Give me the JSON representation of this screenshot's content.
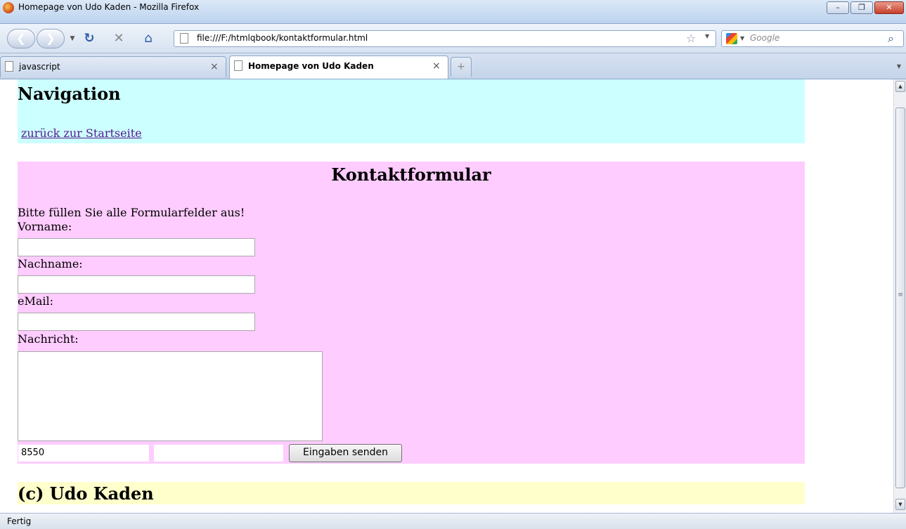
{
  "window": {
    "title": "Homepage von Udo Kaden - Mozilla Firefox",
    "minimize": "–",
    "maximize": "❐",
    "close": "✕"
  },
  "toolbar": {
    "back_icon": "back-arrow-icon",
    "forward_icon": "forward-arrow-icon",
    "url": "file:///F:/htmlqbook/kontaktformular.html",
    "search_placeholder": "Google"
  },
  "tabs": [
    {
      "label": "javascript",
      "active": false
    },
    {
      "label": "Homepage von Udo Kaden",
      "active": true
    }
  ],
  "page": {
    "nav_heading": "Navigation",
    "nav_link": "zurück zur Startseite",
    "form_heading": "Kontaktformular",
    "form_hint": "Bitte füllen Sie alle Formularfelder aus!",
    "fields": [
      {
        "label": "Vorname:",
        "value": ""
      },
      {
        "label": "Nachname:",
        "value": ""
      },
      {
        "label": "eMail:",
        "value": ""
      },
      {
        "label": "Nachricht:",
        "value": ""
      }
    ],
    "captcha_value": "8550",
    "captcha_answer": "",
    "submit_label": "Eingaben senden",
    "footer": "(c) Udo Kaden"
  },
  "status": "Fertig",
  "colors": {
    "nav_bg": "#ccffff",
    "form_bg": "#ffccff",
    "footer_bg": "#ffffcc",
    "link": "#551a8b"
  }
}
